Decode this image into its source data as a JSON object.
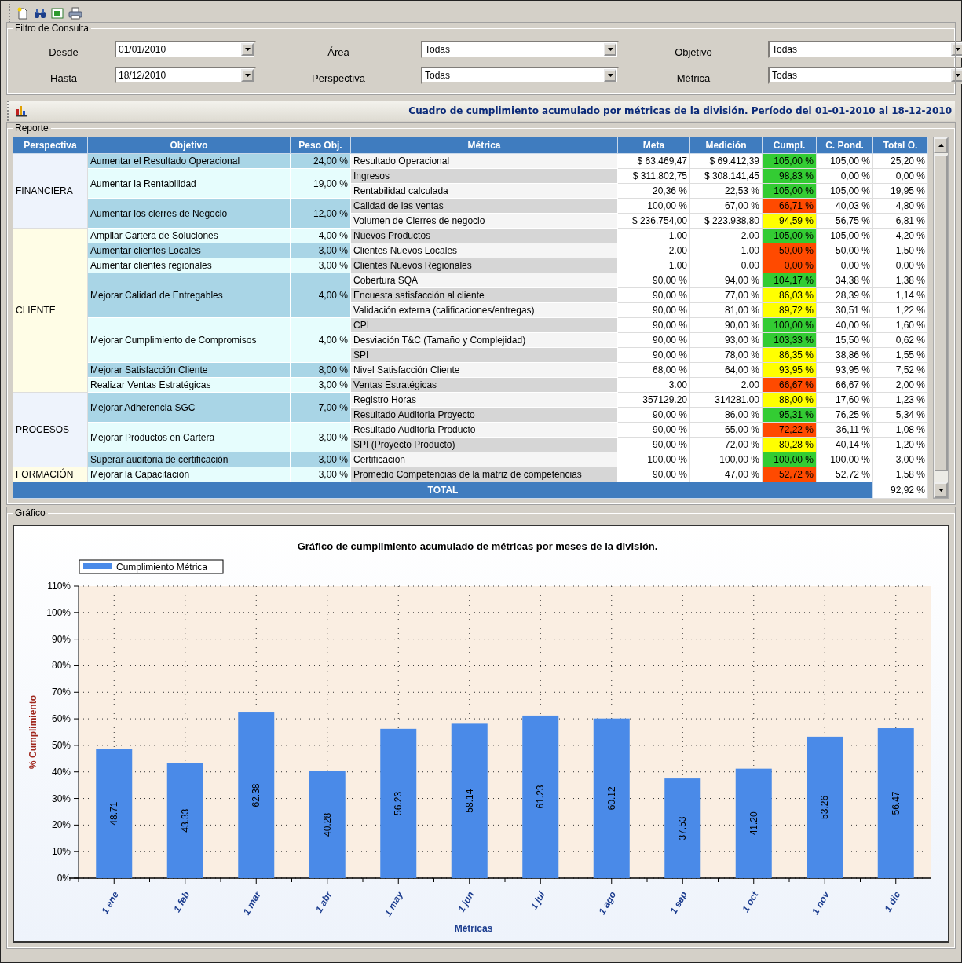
{
  "filter": {
    "title": "Filtro de Consulta",
    "fields": [
      {
        "label": "Desde",
        "value": "01/01/2010"
      },
      {
        "label": "Área",
        "value": "Todas"
      },
      {
        "label": "Objetivo",
        "value": "Todas"
      },
      {
        "label": "Hasta",
        "value": "18/12/2010"
      },
      {
        "label": "Perspectiva",
        "value": "Todas"
      },
      {
        "label": "Métrica",
        "value": "Todas"
      }
    ]
  },
  "report_header": {
    "title": "Cuadro de cumplimiento acumulado por métricas de la división. Período del 01-01-2010 al 18-12-2010"
  },
  "report": {
    "title": "Reporte",
    "columns": [
      "Perspectiva",
      "Objetivo",
      "Peso Obj.",
      "Métrica",
      "Meta",
      "Medición",
      "Cumpl.",
      "C. Pond.",
      "Total O."
    ],
    "perspectives": [
      {
        "name": "FINANCIERA",
        "objectives": [
          {
            "name": "Aumentar el Resultado Operacional",
            "weight": "24,00 %",
            "metrics": [
              {
                "name": "Resultado Operacional",
                "meta": "$ 63.469,47",
                "medicion": "$ 69.412,39",
                "cumpl": "105,00 %",
                "color": "#33cc33",
                "pond": "105,00 %",
                "total": "25,20 %"
              }
            ]
          },
          {
            "name": "Aumentar la Rentabilidad",
            "weight": "19,00 %",
            "metrics": [
              {
                "name": "Ingresos",
                "meta": "$ 311.802,75",
                "medicion": "$ 308.141,45",
                "cumpl": "98,83 %",
                "color": "#33cc33",
                "pond": "0,00 %",
                "total": "0,00 %"
              },
              {
                "name": "Rentabilidad calculada",
                "meta": "20,36 %",
                "medicion": "22,53 %",
                "cumpl": "105,00 %",
                "color": "#33cc33",
                "pond": "105,00 %",
                "total": "19,95 %"
              }
            ]
          },
          {
            "name": "Aumentar los cierres de Negocio",
            "weight": "12,00 %",
            "metrics": [
              {
                "name": "Calidad de las ventas",
                "meta": "100,00 %",
                "medicion": "67,00 %",
                "cumpl": "66,71 %",
                "color": "#ff4a00",
                "pond": "40,03 %",
                "total": "4,80 %"
              },
              {
                "name": "Volumen de Cierres de negocio",
                "meta": "$ 236.754,00",
                "medicion": "$ 223.938,80",
                "cumpl": "94,59 %",
                "color": "#ffff00",
                "pond": "56,75 %",
                "total": "6,81 %"
              }
            ]
          }
        ]
      },
      {
        "name": "CLIENTE",
        "objectives": [
          {
            "name": "Ampliar Cartera de Soluciones",
            "weight": "4,00 %",
            "metrics": [
              {
                "name": "Nuevos Productos",
                "meta": "1.00",
                "medicion": "2.00",
                "cumpl": "105,00 %",
                "color": "#33cc33",
                "pond": "105,00 %",
                "total": "4,20 %"
              }
            ]
          },
          {
            "name": "Aumentar clientes Locales",
            "weight": "3,00 %",
            "metrics": [
              {
                "name": "Clientes Nuevos Locales",
                "meta": "2.00",
                "medicion": "1.00",
                "cumpl": "50,00 %",
                "color": "#ff4a00",
                "pond": "50,00 %",
                "total": "1,50 %"
              }
            ]
          },
          {
            "name": "Aumentar clientes regionales",
            "weight": "3,00 %",
            "metrics": [
              {
                "name": "Clientes Nuevos Regionales",
                "meta": "1.00",
                "medicion": "0.00",
                "cumpl": "0,00 %",
                "color": "#ff4a00",
                "pond": "0,00 %",
                "total": "0,00 %"
              }
            ]
          },
          {
            "name": "Mejorar Calidad de Entregables",
            "weight": "4,00 %",
            "metrics": [
              {
                "name": "Cobertura SQA",
                "meta": "90,00 %",
                "medicion": "94,00 %",
                "cumpl": "104,17 %",
                "color": "#33cc33",
                "pond": "34,38 %",
                "total": "1,38 %"
              },
              {
                "name": "Encuesta satisfacción al cliente",
                "meta": "90,00 %",
                "medicion": "77,00 %",
                "cumpl": "86,03 %",
                "color": "#ffff00",
                "pond": "28,39 %",
                "total": "1,14 %"
              },
              {
                "name": "Validación externa (calificaciones/entregas)",
                "meta": "90,00 %",
                "medicion": "81,00 %",
                "cumpl": "89,72 %",
                "color": "#ffff00",
                "pond": "30,51 %",
                "total": "1,22 %"
              }
            ]
          },
          {
            "name": "Mejorar Cumplimiento de Compromisos",
            "weight": "4,00 %",
            "metrics": [
              {
                "name": "CPI",
                "meta": "90,00 %",
                "medicion": "90,00 %",
                "cumpl": "100,00 %",
                "color": "#33cc33",
                "pond": "40,00 %",
                "total": "1,60 %"
              },
              {
                "name": "Desviación T&C (Tamaño y Complejidad)",
                "meta": "90,00 %",
                "medicion": "93,00 %",
                "cumpl": "103,33 %",
                "color": "#33cc33",
                "pond": "15,50 %",
                "total": "0,62 %"
              },
              {
                "name": "SPI",
                "meta": "90,00 %",
                "medicion": "78,00 %",
                "cumpl": "86,35 %",
                "color": "#ffff00",
                "pond": "38,86 %",
                "total": "1,55 %"
              }
            ]
          },
          {
            "name": "Mejorar Satisfacción Cliente",
            "weight": "8,00 %",
            "metrics": [
              {
                "name": "Nivel Satisfacción Cliente",
                "meta": "68,00 %",
                "medicion": "64,00 %",
                "cumpl": "93,95 %",
                "color": "#ffff00",
                "pond": "93,95 %",
                "total": "7,52 %"
              }
            ]
          },
          {
            "name": "Realizar Ventas Estratégicas",
            "weight": "3,00 %",
            "metrics": [
              {
                "name": "Ventas Estratégicas",
                "meta": "3.00",
                "medicion": "2.00",
                "cumpl": "66,67 %",
                "color": "#ff4a00",
                "pond": "66,67 %",
                "total": "2,00 %"
              }
            ]
          }
        ]
      },
      {
        "name": "PROCESOS",
        "objectives": [
          {
            "name": "Mejorar Adherencia SGC",
            "weight": "7,00 %",
            "metrics": [
              {
                "name": "Registro Horas",
                "meta": "357129.20",
                "medicion": "314281.00",
                "cumpl": "88,00 %",
                "color": "#ffff00",
                "pond": "17,60 %",
                "total": "1,23 %"
              },
              {
                "name": "Resultado Auditoria Proyecto",
                "meta": "90,00 %",
                "medicion": "86,00 %",
                "cumpl": "95,31 %",
                "color": "#33cc33",
                "pond": "76,25 %",
                "total": "5,34 %"
              }
            ]
          },
          {
            "name": "Mejorar Productos en Cartera",
            "weight": "3,00 %",
            "metrics": [
              {
                "name": "Resultado Auditoria Producto",
                "meta": "90,00 %",
                "medicion": "65,00 %",
                "cumpl": "72,22 %",
                "color": "#ff4a00",
                "pond": "36,11 %",
                "total": "1,08 %"
              },
              {
                "name": "SPI (Proyecto Producto)",
                "meta": "90,00 %",
                "medicion": "72,00 %",
                "cumpl": "80,28 %",
                "color": "#ffff00",
                "pond": "40,14 %",
                "total": "1,20 %"
              }
            ]
          },
          {
            "name": "Superar auditoria de certificación",
            "weight": "3,00 %",
            "metrics": [
              {
                "name": "Certificación",
                "meta": "100,00 %",
                "medicion": "100,00 %",
                "cumpl": "100,00 %",
                "color": "#33cc33",
                "pond": "100,00 %",
                "total": "3,00 %"
              }
            ]
          }
        ]
      },
      {
        "name": "FORMACIÓN",
        "objectives": [
          {
            "name": "Mejorar la Capacitación",
            "weight": "3,00 %",
            "metrics": [
              {
                "name": "Promedio Competencias de la matriz de competencias",
                "meta": "90,00 %",
                "medicion": "47,00 %",
                "cumpl": "52,72 %",
                "color": "#ff4a00",
                "pond": "52,72 %",
                "total": "1,58 %"
              }
            ]
          }
        ]
      }
    ],
    "total_label": "TOTAL",
    "total_value": "92,92 %"
  },
  "chart_section": {
    "title": "Gráfico",
    "chart_data": {
      "type": "bar",
      "title": "Gráfico de cumplimiento acumulado de métricas por meses de la división.",
      "xlabel": "Métricas",
      "ylabel": "% Cumplimiento",
      "categories": [
        "1 ene",
        "1 feb",
        "1 mar",
        "1 abr",
        "1 may",
        "1 jun",
        "1 jul",
        "1 ago",
        "1 sep",
        "1 oct",
        "1 nov",
        "1 dic"
      ],
      "series": [
        {
          "name": "Cumplimiento Métrica",
          "color": "#4a8ae8",
          "values": [
            48.71,
            43.33,
            62.38,
            40.28,
            56.23,
            58.14,
            61.23,
            60.12,
            37.53,
            41.2,
            53.26,
            56.47
          ]
        }
      ],
      "value_labels": [
        "48.71",
        "43.33",
        "62.38",
        "40.28",
        "56.23",
        "58.14",
        "61.23",
        "60.12",
        "37.53",
        "41.20",
        "53.26",
        "56.47"
      ],
      "ylim": [
        0,
        110
      ],
      "grid": true,
      "yticks": [
        {
          "value": 0,
          "label": "0%"
        },
        {
          "value": 10,
          "label": "10%"
        },
        {
          "value": 20,
          "label": "20%"
        },
        {
          "value": 30,
          "label": "30%"
        },
        {
          "value": 40,
          "label": "40%"
        },
        {
          "value": 50,
          "label": "50%"
        },
        {
          "value": 60,
          "label": "60%"
        },
        {
          "value": 70,
          "label": "70%"
        },
        {
          "value": 80,
          "label": "80%"
        },
        {
          "value": 90,
          "label": "90%"
        },
        {
          "value": 100,
          "label": "100%"
        },
        {
          "value": 110,
          "label": "110%"
        }
      ]
    }
  }
}
